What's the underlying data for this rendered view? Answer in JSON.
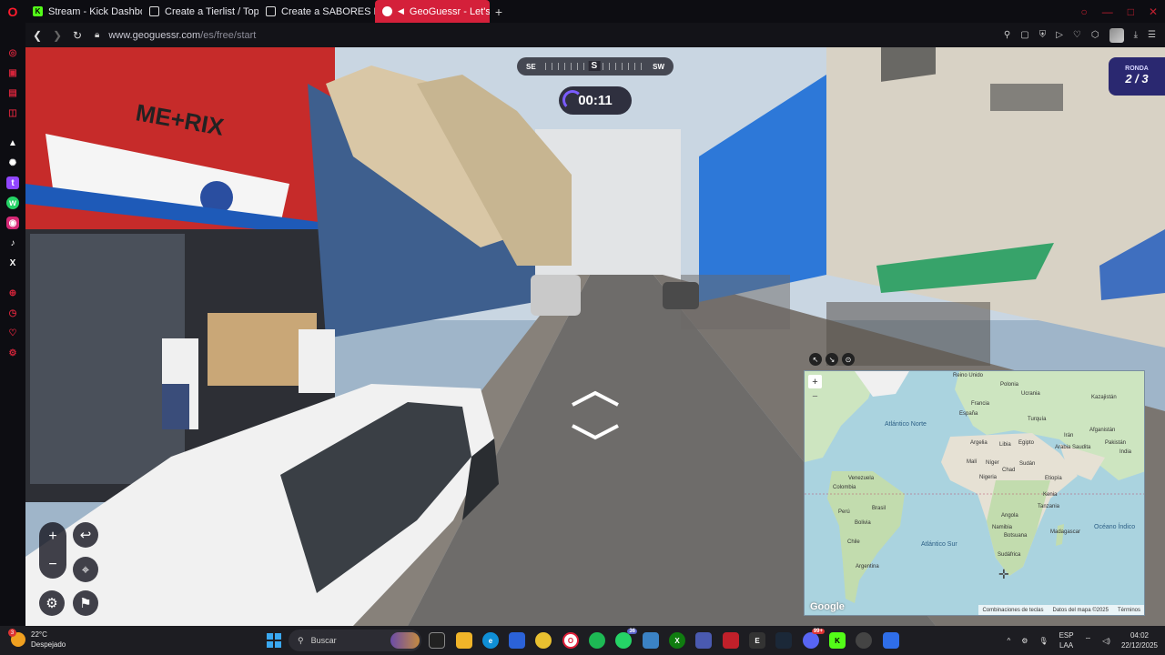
{
  "browser": {
    "tabs": [
      {
        "title": "Stream - Kick Dashboard",
        "icon": "kick-icon",
        "color": "#53fc18",
        "active": false
      },
      {
        "title": "Create a Tierlist / Top de...",
        "icon": "page-icon",
        "color": "#dddddd",
        "active": false
      },
      {
        "title": "Create a SABORES DE HE...",
        "icon": "page-icon",
        "color": "#dddddd",
        "active": false
      },
      {
        "title": "GeoGuessr - Let's exp...",
        "icon": "geoguessr-icon",
        "color": "#ffffff",
        "active": true
      }
    ],
    "new_tab_symbol": "+",
    "url_host": "www.geoguessr.com",
    "url_path": "/es/free/start",
    "accent": "#d4203a"
  },
  "game": {
    "compass_left": "SE",
    "compass_center": "S",
    "compass_right": "SW",
    "timer": "00:11",
    "round_label": "RONDA",
    "round_value": "2 / 3"
  },
  "map": {
    "oceans": [
      "Atlántico Norte",
      "Atlántico Sur",
      "Océano Índico"
    ],
    "countries": [
      "Reino Unido",
      "Polonia",
      "Ucrania",
      "Kazajistán",
      "Francia",
      "España",
      "Turquía",
      "Irán",
      "Afganistán",
      "Pakistán",
      "India",
      "Argelia",
      "Libia",
      "Egipto",
      "Arabia Saudita",
      "Malí",
      "Níger",
      "Chad",
      "Sudán",
      "Etiopía",
      "Nigeria",
      "Kenia",
      "Tanzania",
      "Angola",
      "Namibia",
      "Botsuana",
      "Sudáfrica",
      "Madagascar",
      "Venezuela",
      "Colombia",
      "Perú",
      "Brasil",
      "Bolivia",
      "Chile",
      "Argentina"
    ],
    "footer": [
      "Combinaciones de teclas",
      "Datos del mapa ©2025",
      "Términos"
    ],
    "logo": "Google"
  },
  "taskbar": {
    "temperature": "22°C",
    "weather": "Despejado",
    "weather_badge": "3",
    "search_placeholder": "Buscar",
    "whatsapp_badge": "36",
    "discord_badge": "99+",
    "lang_top": "ESP",
    "lang_bottom": "LAA",
    "time": "04:02",
    "date": "22/12/2025"
  }
}
